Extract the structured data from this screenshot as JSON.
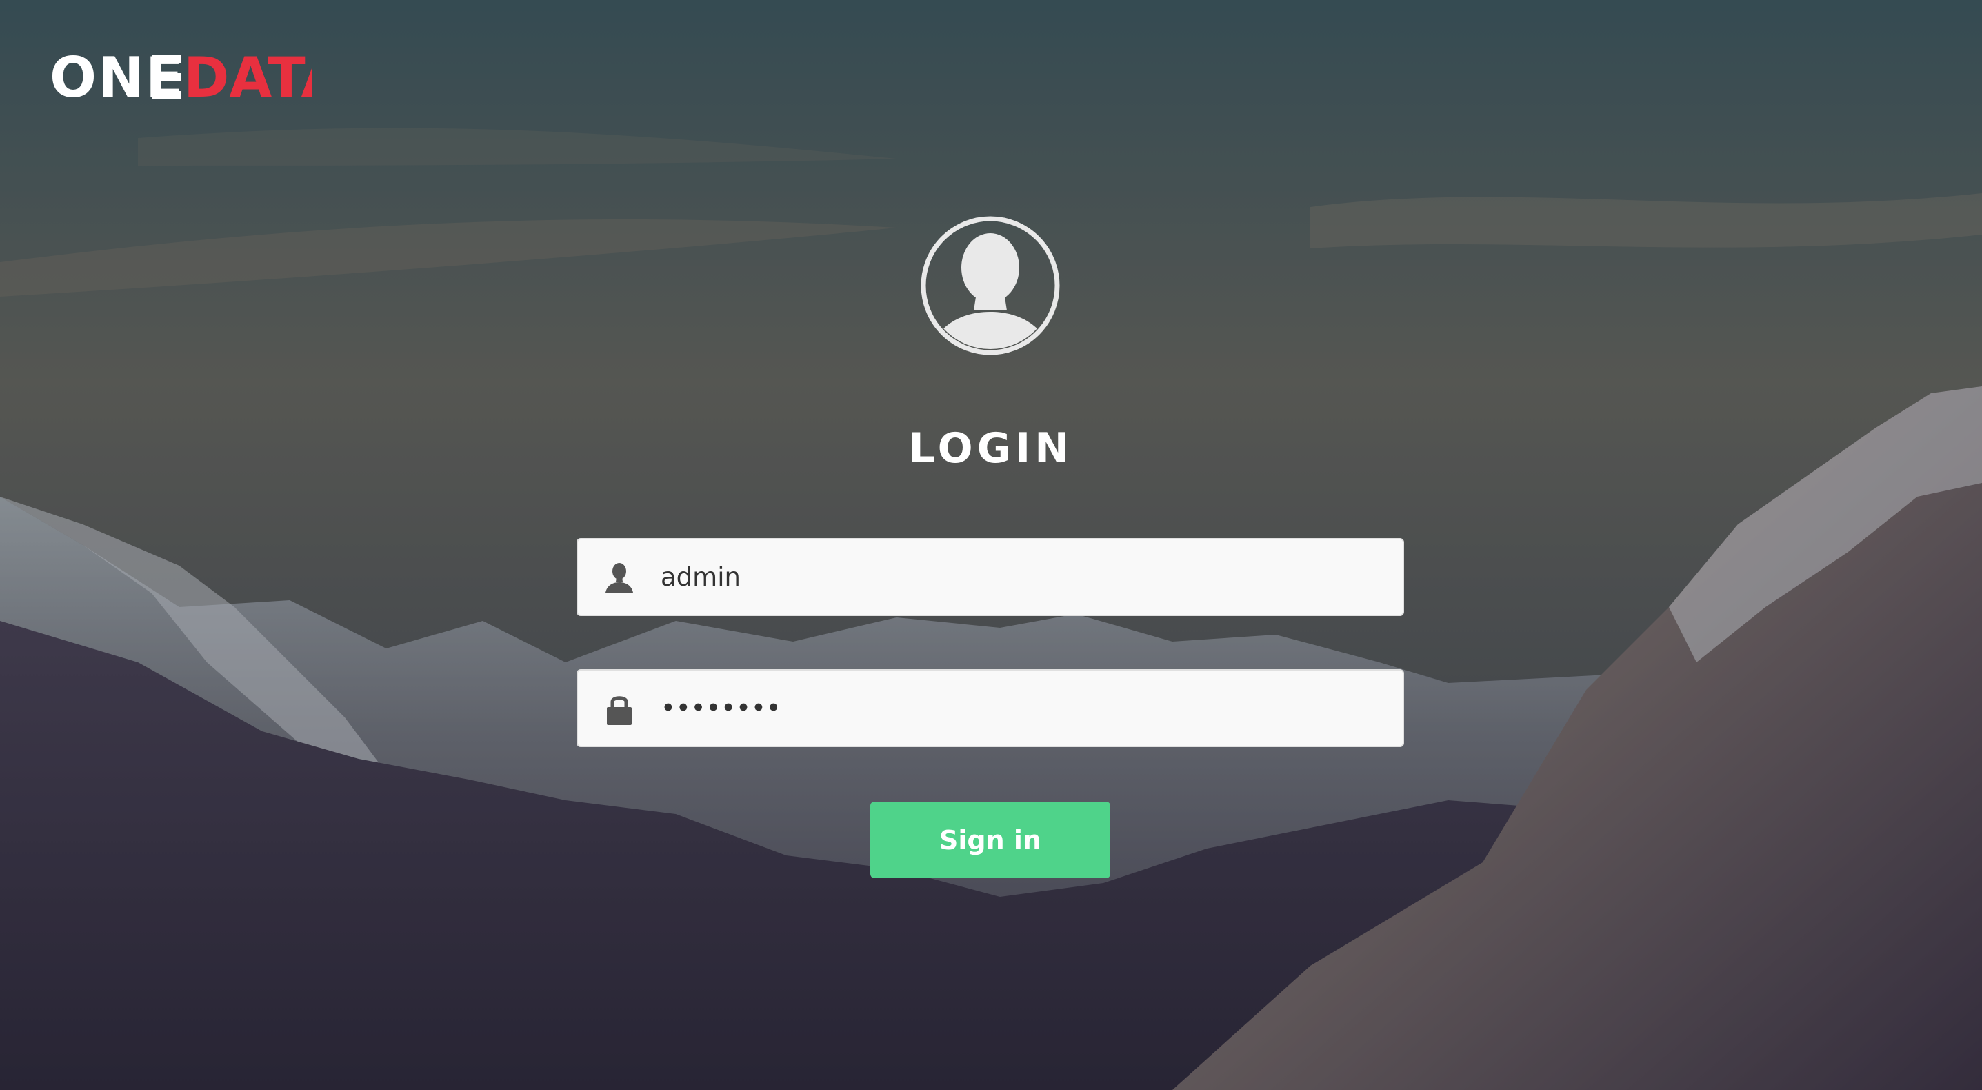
{
  "brand": {
    "logo_text_left": "ONE",
    "logo_text_right": "DATA",
    "color_white": "#ffffff",
    "color_red": "#e8303f"
  },
  "login": {
    "title": "LOGIN",
    "avatar_icon": "user-avatar-icon",
    "username": {
      "icon": "user-icon",
      "value": "admin",
      "placeholder": ""
    },
    "password": {
      "icon": "lock-icon",
      "value": "••••••••",
      "placeholder": ""
    },
    "submit_label": "Sign in",
    "submit_color": "#4fd38a"
  }
}
